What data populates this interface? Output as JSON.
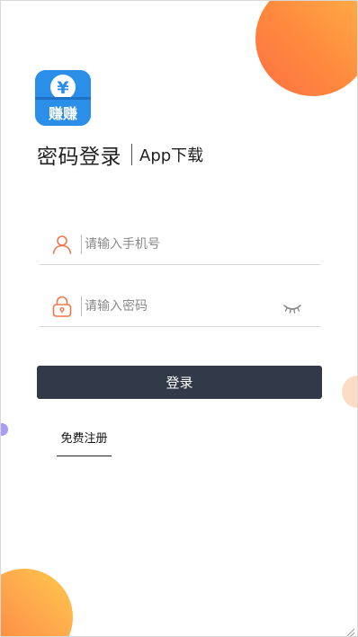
{
  "brand": {
    "logo_text": "赚赚",
    "logo_symbol": "¥",
    "logo_color": "#2b8ee8"
  },
  "header": {
    "title": "密码登录",
    "subtitle": "App下载"
  },
  "form": {
    "phone": {
      "placeholder": "请输入手机号",
      "value": "",
      "icon": "user-icon"
    },
    "password": {
      "placeholder": "请输入密码",
      "value": "",
      "icon": "lock-icon",
      "toggle_icon": "eye-closed-icon"
    },
    "submit_label": "登录",
    "submit_color": "#323a4a"
  },
  "footer": {
    "register_label": "免费注册"
  },
  "colors": {
    "accent_orange": "#ff7a3d",
    "accent_yellow": "#ffb347",
    "accent_purple": "#a99cf3"
  }
}
